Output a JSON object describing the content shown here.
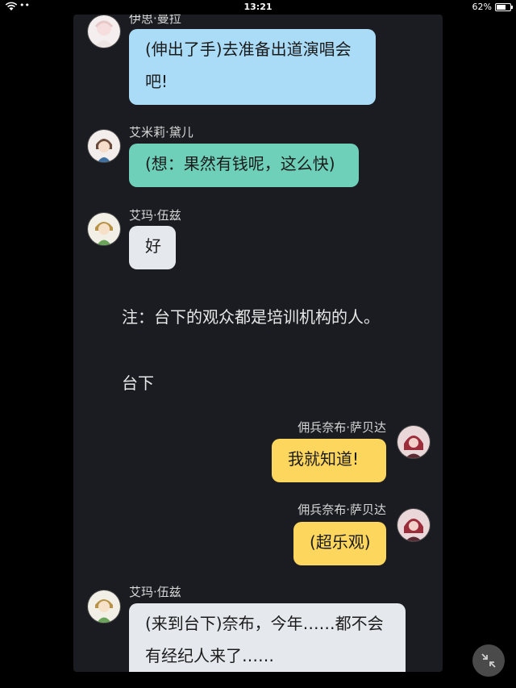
{
  "status_bar": {
    "time": "13:21",
    "battery": "62%",
    "signal_dots": "••",
    "battery_level": 0.62
  },
  "messages": [
    {
      "speaker": "伊思·曼拉",
      "text_lines": [
        "(伸出了手)去准备出道演唱会",
        "吧!"
      ],
      "color": "#aadcf8",
      "side": "left"
    },
    {
      "speaker": "艾米莉·黛儿",
      "text_lines": [
        "(想：果然有钱呢，这么快)"
      ],
      "color": "#6fd0ba",
      "side": "left"
    },
    {
      "speaker": "艾玛·伍兹",
      "text_lines": [
        "好"
      ],
      "color": "#e5e8ed",
      "side": "left"
    },
    {
      "narration": "注：台下的观众都是培训机构的人。"
    },
    {
      "narration": "台下"
    },
    {
      "speaker": "佣兵奈布·萨贝达",
      "text_lines": [
        "我就知道!"
      ],
      "color": "#fdd65e",
      "side": "right"
    },
    {
      "speaker": "佣兵奈布·萨贝达",
      "text_lines": [
        "(超乐观)"
      ],
      "color": "#fdd65e",
      "side": "right"
    },
    {
      "speaker": "艾玛·伍兹",
      "text_lines": [
        "(来到台下)奈布，今年……都不会",
        "有经纪人来了……"
      ],
      "color": "#e5e8ed",
      "side": "left"
    }
  ],
  "icons": {
    "wifi": "wifi-icon",
    "battery": "battery-icon",
    "collapse": "collapse-arrows-icon"
  }
}
